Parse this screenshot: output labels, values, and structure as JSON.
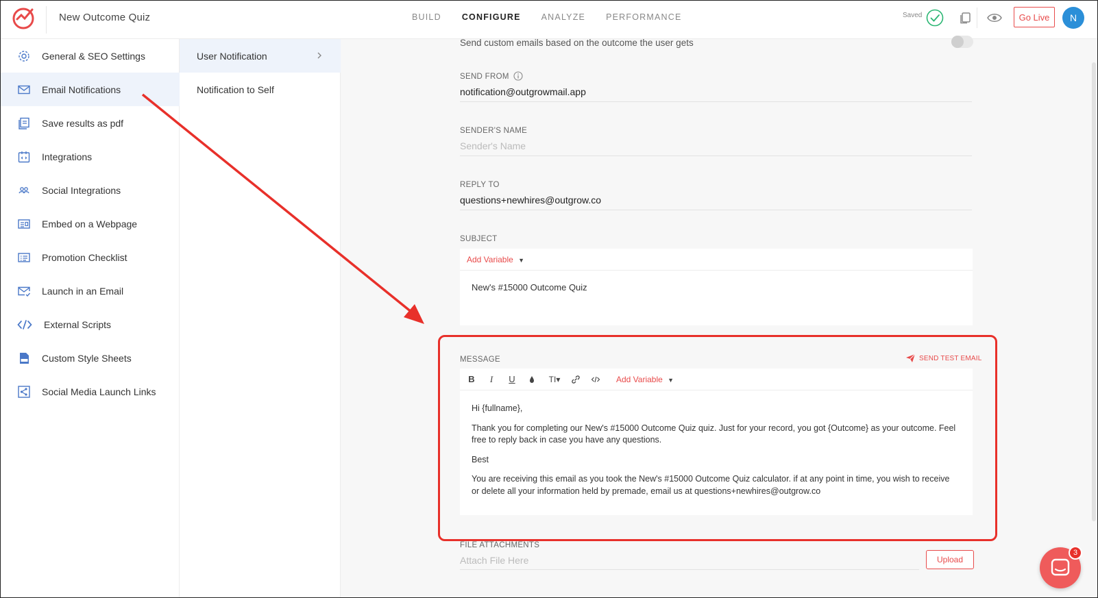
{
  "app": {
    "title": "New Outcome Quiz"
  },
  "nav": {
    "tabs": [
      {
        "label": "BUILD"
      },
      {
        "label": "CONFIGURE"
      },
      {
        "label": "ANALYZE"
      },
      {
        "label": "PERFORMANCE"
      }
    ],
    "active": "CONFIGURE"
  },
  "header": {
    "saved_label": "Saved",
    "golive_label": "Go Live",
    "avatar_initial": "N"
  },
  "sidebar": {
    "items": [
      {
        "label": "General & SEO Settings",
        "icon": "gear-icon"
      },
      {
        "label": "Email Notifications",
        "icon": "envelope-icon"
      },
      {
        "label": "Save results as pdf",
        "icon": "pdf-icon"
      },
      {
        "label": "Integrations",
        "icon": "integrations-icon"
      },
      {
        "label": "Social Integrations",
        "icon": "people-icon"
      },
      {
        "label": "Embed on a Webpage",
        "icon": "embed-icon"
      },
      {
        "label": "Promotion Checklist",
        "icon": "checklist-icon"
      },
      {
        "label": "Launch in an Email",
        "icon": "email-launch-icon"
      },
      {
        "label": "External Scripts",
        "icon": "code-icon"
      },
      {
        "label": "Custom Style Sheets",
        "icon": "css-file-icon"
      },
      {
        "label": "Social Media Launch Links",
        "icon": "share-icon"
      }
    ],
    "active_index": 1
  },
  "submenu": {
    "items": [
      {
        "label": "User Notification"
      },
      {
        "label": "Notification to Self"
      }
    ],
    "active_index": 0
  },
  "form": {
    "description": "Send custom emails based on the outcome the user gets",
    "send_from": {
      "label": "SEND FROM",
      "value": "notification@outgrowmail.app"
    },
    "sender_name": {
      "label": "SENDER'S NAME",
      "placeholder": "Sender's Name"
    },
    "reply_to": {
      "label": "REPLY TO",
      "value": "questions+newhires@outgrow.co"
    },
    "subject": {
      "label": "SUBJECT",
      "add_variable": "Add Variable",
      "value": "New's #15000 Outcome Quiz"
    },
    "message": {
      "label": "MESSAGE",
      "send_test": "SEND TEST EMAIL",
      "add_variable": "Add Variable",
      "paragraphs": [
        "Hi {fullname},",
        "Thank you for completing our New's #15000 Outcome Quiz quiz. Just for your record, you got {Outcome} as your outcome. Feel free to reply back in case you have any questions.",
        "Best",
        "You are receiving this email as you took the New's #15000 Outcome Quiz calculator. if at any point in time, you wish to receive or delete all your information held by premade, email us at questions+newhires@outgrow.co"
      ]
    },
    "attachments": {
      "label": "FILE ATTACHMENTS",
      "placeholder": "Attach File Here",
      "upload_label": "Upload"
    }
  },
  "chat": {
    "badge_count": "3"
  },
  "colors": {
    "accent": "#e84a4a",
    "annotation": "#e8302a",
    "avatar": "#2b8fd8",
    "saved_check": "#2bb673"
  }
}
